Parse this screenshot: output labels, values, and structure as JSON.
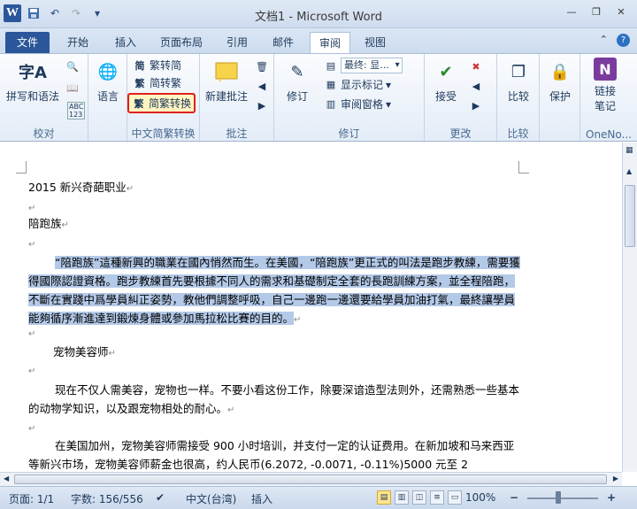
{
  "window": {
    "title": "文档1 - Microsoft Word"
  },
  "qat": {
    "app_icon": "W",
    "save_icon": "save-icon",
    "undo_icon": "undo-icon",
    "redo_icon": "redo-icon",
    "menu_icon": "▾"
  },
  "tabs": [
    "文件",
    "开始",
    "插入",
    "页面布局",
    "引用",
    "邮件",
    "审阅",
    "视图"
  ],
  "ribbon": {
    "proofing": {
      "label": "校对",
      "spell": "拼写和语法",
      "spell_icon": "字A",
      "abc": "ABC\n123"
    },
    "language": {
      "label": "语言",
      "icon": "🌐"
    },
    "chinese": {
      "label": "中文简繁转换",
      "to_simplified": "繁转简",
      "to_traditional": "简转繁",
      "convert": "简繁转换",
      "ic_simp": "简",
      "ic_trad": "繁",
      "ic_conv": "繁"
    },
    "comments": {
      "label": "批注",
      "new": "新建批注"
    },
    "tracking": {
      "label": "修订",
      "track": "修订",
      "display": "最终: 显...",
      "show_markup": "显示标记",
      "review_pane": "审阅窗格"
    },
    "changes": {
      "label": "更改",
      "accept": "接受"
    },
    "compare": {
      "label": "比较",
      "btn": "比较"
    },
    "protect": {
      "label": "",
      "btn": "保护"
    },
    "onenote": {
      "label": "OneNo...",
      "btn_line1": "链接",
      "btn_line2": "笔记",
      "icon": "N"
    }
  },
  "document": {
    "lines": [
      "2015 新兴奇葩职业",
      "陪跑族"
    ],
    "selected_para": "“陪跑族”這種新興的職業在國內悄然而生。在美國，“陪跑族”更正式的叫法是跑步教練，需要獲得國際認證資格。跑步教練首先要根據不同人的需求和基礎制定全套的長跑訓練方案，並全程陪跑，不斷在實踐中爲學員糾正姿勢，教他們調整呼吸，自己一邊跑一邊還要給學員加油打氣，最終讓學員能夠循序漸進達到鍛煉身體或參加馬拉松比賽的目的。",
    "heading2": "宠物美容师",
    "para2": "现在不仅人需美容，宠物也一样。不要小看这份工作，除要深谙造型法则外，还需熟悉一些基本的动物学知识，以及跟宠物相处的耐心。",
    "para3": "在美国加州，宠物美容师需接受 900 小时培训，并支付一定的认证费用。在新加坡和马来西亚等新兴市场，宠物美容师薪金也很高，约人民币(6.2072, -0.0071, -0.11%)5000 元至 2",
    "para_mark": "↵"
  },
  "status": {
    "page": "页面: 1/1",
    "words": "字数: 156/556",
    "language": "中文(台湾)",
    "insert": "插入",
    "zoom": "100%",
    "zoom_minus": "−",
    "zoom_plus": "+"
  },
  "colors": {
    "selection": "#b3c9e8",
    "file_tab": "#2b579a",
    "highlight_box": "#e02020"
  }
}
